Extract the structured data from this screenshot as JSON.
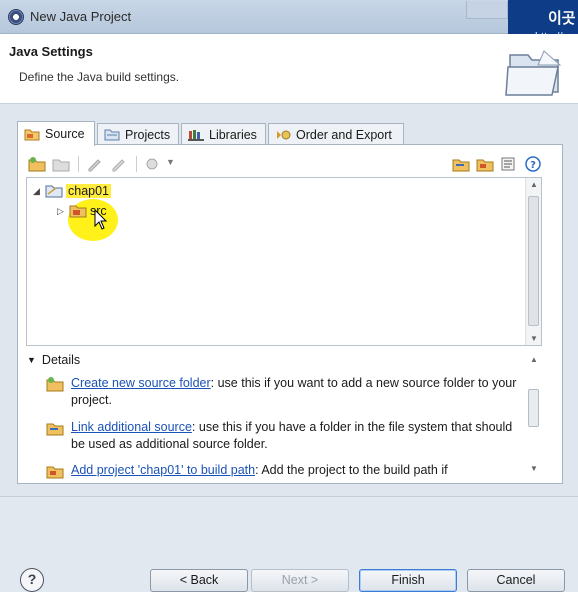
{
  "window": {
    "title": "New Java Project",
    "overlay_text_1": "이곳",
    "overlay_text_2": "http://c"
  },
  "header": {
    "title": "Java Settings",
    "description": "Define the Java build settings."
  },
  "tabs": [
    {
      "label": "Source",
      "icon": "source-folder-icon",
      "active": true
    },
    {
      "label": "Projects",
      "icon": "projects-icon",
      "active": false
    },
    {
      "label": "Libraries",
      "icon": "libraries-icon",
      "active": false
    },
    {
      "label": "Order and Export",
      "icon": "order-export-icon",
      "active": false
    }
  ],
  "tree": {
    "project": "chap01",
    "child": "src"
  },
  "details": {
    "heading": "Details",
    "items": [
      {
        "link": "Create new source folder",
        "text": ": use this if you want to add a new source folder to your project."
      },
      {
        "link": "Link additional source",
        "text": ": use this if you have a folder in the file system that should be used as additional source folder."
      },
      {
        "link": "Add project 'chap01' to build path",
        "text": ": Add the project to the build path if"
      }
    ]
  },
  "buttons": {
    "help": "?",
    "back": "< Back",
    "next": "Next >",
    "finish": "Finish",
    "cancel": "Cancel"
  },
  "colors": {
    "link": "#1b52b8",
    "highlight": "#ffec3d",
    "overlay": "#0f3c86"
  }
}
